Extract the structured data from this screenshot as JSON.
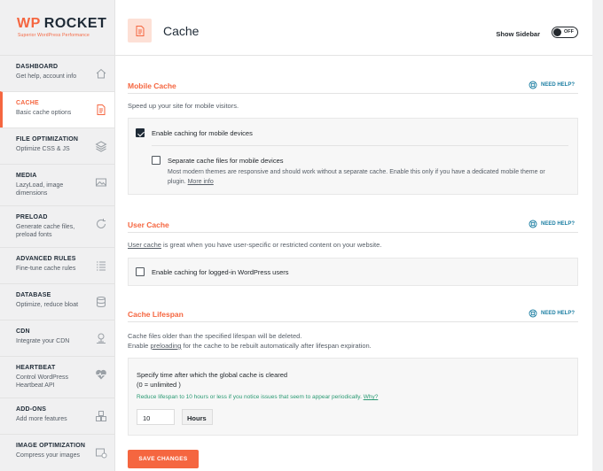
{
  "brand": {
    "wp": "WP",
    "name": "ROCKET",
    "tagline": "Superior WordPress Performance",
    "accent": "#f56640"
  },
  "sidebar": {
    "items": [
      {
        "title": "DASHBOARD",
        "desc": "Get help, account info",
        "icon": "home-icon"
      },
      {
        "title": "CACHE",
        "desc": "Basic cache options",
        "icon": "document-icon",
        "active": true
      },
      {
        "title": "FILE OPTIMIZATION",
        "desc": "Optimize CSS & JS",
        "icon": "layers-icon"
      },
      {
        "title": "MEDIA",
        "desc": "LazyLoad, image dimensions",
        "icon": "image-icon"
      },
      {
        "title": "PRELOAD",
        "desc": "Generate cache files, preload fonts",
        "icon": "refresh-icon"
      },
      {
        "title": "ADVANCED RULES",
        "desc": "Fine-tune cache rules",
        "icon": "list-icon"
      },
      {
        "title": "DATABASE",
        "desc": "Optimize, reduce bloat",
        "icon": "database-icon"
      },
      {
        "title": "CDN",
        "desc": "Integrate your CDN",
        "icon": "cdn-icon"
      },
      {
        "title": "HEARTBEAT",
        "desc": "Control WordPress Heartbeat API",
        "icon": "heartbeat-icon"
      },
      {
        "title": "ADD-ONS",
        "desc": "Add more features",
        "icon": "addons-icon"
      },
      {
        "title": "IMAGE OPTIMIZATION",
        "desc": "Compress your images",
        "icon": "image-optimization-icon"
      }
    ]
  },
  "header": {
    "title": "Cache",
    "show_sidebar_label": "Show Sidebar",
    "toggle_state": "OFF"
  },
  "need_help": "NEED HELP?",
  "mobile_cache": {
    "title": "Mobile Cache",
    "desc": "Speed up your site for mobile visitors.",
    "enable_label": "Enable caching for mobile devices",
    "enable_checked": true,
    "separate_label": "Separate cache files for mobile devices",
    "separate_checked": false,
    "separate_desc": "Most modern themes are responsive and should work without a separate cache. Enable this only if you have a dedicated mobile theme or plugin.",
    "more_info": "More info"
  },
  "user_cache": {
    "title": "User Cache",
    "desc_link": "User cache",
    "desc_rest": " is great when you have user-specific or restricted content on your website.",
    "enable_label": "Enable caching for logged-in WordPress users",
    "enable_checked": false
  },
  "cache_lifespan": {
    "title": "Cache Lifespan",
    "desc_line1": "Cache files older than the specified lifespan will be deleted.",
    "desc_line2_pre": "Enable ",
    "desc_line2_link": "preloading",
    "desc_line2_post": " for the cache to be rebuilt automatically after lifespan expiration.",
    "field_title": "Specify time after which the global cache is cleared",
    "field_subtitle": "(0 = unlimited )",
    "hint": "Reduce lifespan to 10 hours or less if you notice issues that seem to appear periodically. ",
    "hint_link": "Why?",
    "value": "10",
    "unit": "Hours"
  },
  "save_button": "SAVE CHANGES"
}
